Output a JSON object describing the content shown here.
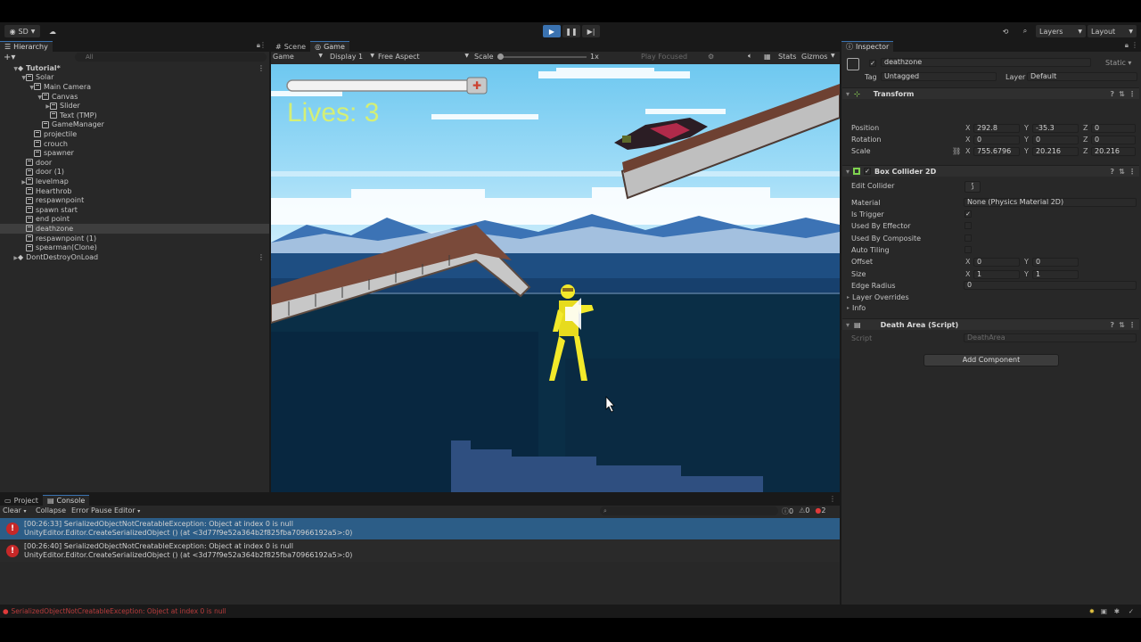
{
  "toolbar": {
    "account": "SD",
    "layers": "Layers",
    "layout": "Layout"
  },
  "hierarchy": {
    "tab": "Hierarchy",
    "search_placeholder": "All",
    "items": [
      {
        "label": "Tutorial*",
        "indent": 0,
        "type": "scene",
        "expanded": true
      },
      {
        "label": "Solar",
        "indent": 1,
        "type": "obj",
        "expanded": true
      },
      {
        "label": "Main Camera",
        "indent": 2,
        "type": "obj",
        "expanded": true
      },
      {
        "label": "Canvas",
        "indent": 3,
        "type": "obj",
        "expanded": true
      },
      {
        "label": "Slider",
        "indent": 4,
        "type": "obj",
        "expanded": false,
        "arrow": true
      },
      {
        "label": "Text (TMP)",
        "indent": 4,
        "type": "obj"
      },
      {
        "label": "GameManager",
        "indent": 3,
        "type": "obj"
      },
      {
        "label": "projectile",
        "indent": 2,
        "type": "obj"
      },
      {
        "label": "crouch",
        "indent": 2,
        "type": "obj"
      },
      {
        "label": "spawner",
        "indent": 2,
        "type": "obj"
      },
      {
        "label": "door",
        "indent": 1,
        "type": "obj"
      },
      {
        "label": "door (1)",
        "indent": 1,
        "type": "obj"
      },
      {
        "label": "levelmap",
        "indent": 1,
        "type": "obj",
        "expanded": false,
        "arrow": true
      },
      {
        "label": "Hearthrob",
        "indent": 1,
        "type": "obj"
      },
      {
        "label": "respawnpoint",
        "indent": 1,
        "type": "obj"
      },
      {
        "label": "spawn start",
        "indent": 1,
        "type": "obj"
      },
      {
        "label": "end point",
        "indent": 1,
        "type": "obj"
      },
      {
        "label": "deathzone",
        "indent": 1,
        "type": "obj",
        "selected": true
      },
      {
        "label": "respawnpoint (1)",
        "indent": 1,
        "type": "obj"
      },
      {
        "label": "spearman(Clone)",
        "indent": 1,
        "type": "obj"
      },
      {
        "label": "DontDestroyOnLoad",
        "indent": 0,
        "type": "scene",
        "expanded": false,
        "arrow": true
      }
    ]
  },
  "center": {
    "tabs": [
      "Scene",
      "Game"
    ],
    "game_dropdown": "Game",
    "display": "Display 1",
    "aspect": "Free Aspect",
    "scale_label": "Scale",
    "scale_value": "1x",
    "play_focused": "Play Focused",
    "stats": "Stats",
    "gizmos": "Gizmos",
    "hud_lives": "Lives: 3"
  },
  "inspector": {
    "tab": "Inspector",
    "object_name": "deathzone",
    "static_label": "Static",
    "tag_label": "Tag",
    "tag_value": "Untagged",
    "layer_label": "Layer",
    "layer_value": "Default",
    "transform": {
      "title": "Transform",
      "position_label": "Position",
      "rotation_label": "Rotation",
      "scale_label": "Scale",
      "position": [
        "292.8",
        "-35.3",
        "0"
      ],
      "rotation": [
        "0",
        "0",
        "0"
      ],
      "scale": [
        "755.6796",
        "20.216",
        "20.216"
      ]
    },
    "collider": {
      "title": "Box Collider 2D",
      "edit_collider": "Edit Collider",
      "material_label": "Material",
      "material_value": "None (Physics Material 2D)",
      "is_trigger": "Is Trigger",
      "used_by_effector": "Used By Effector",
      "used_by_composite": "Used By Composite",
      "auto_tiling": "Auto Tiling",
      "offset_label": "Offset",
      "offset": [
        "0",
        "0"
      ],
      "size_label": "Size",
      "size": [
        "1",
        "1"
      ],
      "edge_radius_label": "Edge Radius",
      "edge_radius": "0",
      "layer_overrides": "Layer Overrides",
      "info": "Info"
    },
    "script": {
      "title": "Death Area (Script)",
      "script_label": "Script",
      "script_value": "DeathArea"
    },
    "add_component": "Add Component",
    "axes": {
      "x": "X",
      "y": "Y",
      "z": "Z"
    }
  },
  "console": {
    "tabs": [
      "Project",
      "Console"
    ],
    "clear": "Clear",
    "collapse": "Collapse",
    "error_pause": "Error Pause",
    "editor": "Editor",
    "counts": {
      "info": "0",
      "warn": "0",
      "error": "2"
    },
    "logs": [
      {
        "line1": "[00:26:33] SerializedObjectNotCreatableException: Object at index 0 is null",
        "line2": "UnityEditor.Editor.CreateSerializedObject () (at <3d77f9e52a364b2f825fba70966192a5>:0)",
        "selected": true
      },
      {
        "line1": "[00:26:40] SerializedObjectNotCreatableException: Object at index 0 is null",
        "line2": "UnityEditor.Editor.CreateSerializedObject () (at <3d77f9e52a364b2f825fba70966192a5>:0)",
        "selected": false
      }
    ],
    "status": "SerializedObjectNotCreatableException: Object at index 0 is null"
  },
  "colors": {
    "accent": "#3a72b0",
    "error": "#c62828",
    "hud": "#ffff33"
  }
}
